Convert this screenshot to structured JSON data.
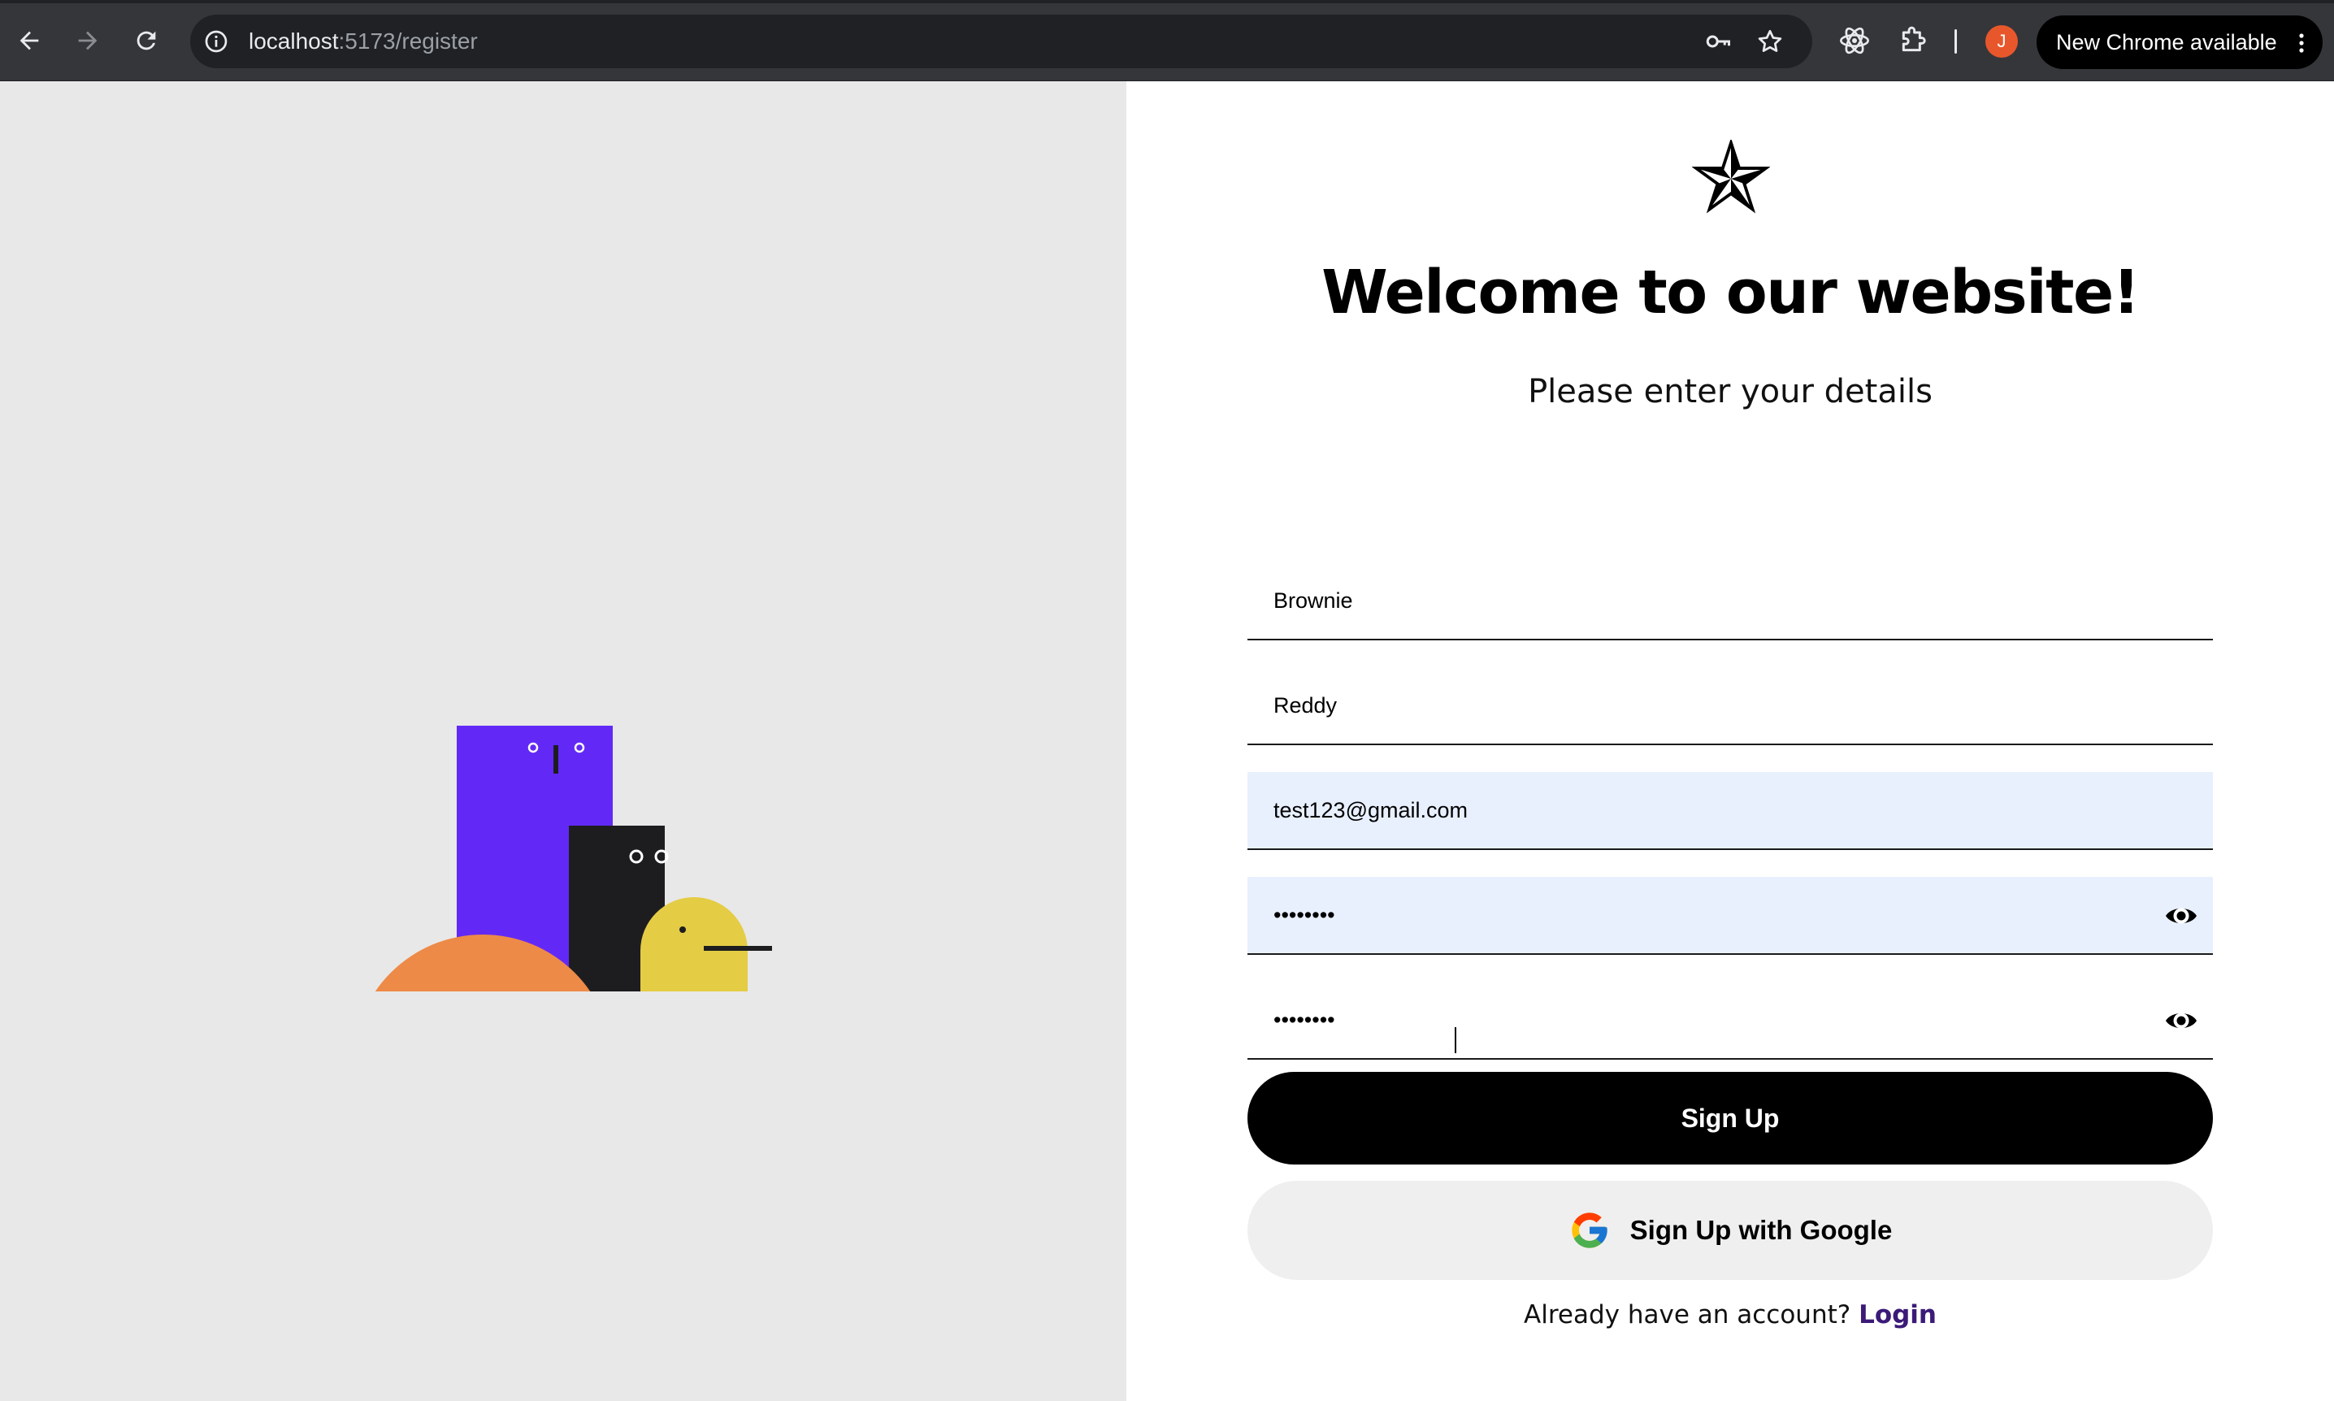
{
  "browser": {
    "url_host": "localhost",
    "url_path": ":5173/register",
    "avatar_initial": "J",
    "update_label": "New Chrome available"
  },
  "page": {
    "title": "Welcome to our website!",
    "subtitle": "Please enter your details",
    "fields": {
      "first_name": "Brownie",
      "last_name": "Reddy",
      "email": "test123@gmail.com",
      "password": "••••••••",
      "confirm_password": "••••••••"
    },
    "sign_up_label": "Sign Up",
    "google_label": "Sign Up with Google",
    "footer_prompt": "Already have an account?",
    "login_link": "Login"
  },
  "colors": {
    "illustration_purple": "#6229f6",
    "illustration_black": "#1d1d20",
    "illustration_orange": "#ee8a47",
    "illustration_yellow": "#e4cc45",
    "autofill_bg": "#e8f0fe",
    "login_link": "#3b1a78"
  },
  "icons": [
    "back-icon",
    "forward-icon",
    "reload-icon",
    "site-info-icon",
    "password-key-icon",
    "bookmark-star-icon",
    "react-devtools-icon",
    "extensions-icon",
    "kebab-menu-icon",
    "star-logo-icon",
    "eye-icon",
    "google-logo-icon"
  ]
}
